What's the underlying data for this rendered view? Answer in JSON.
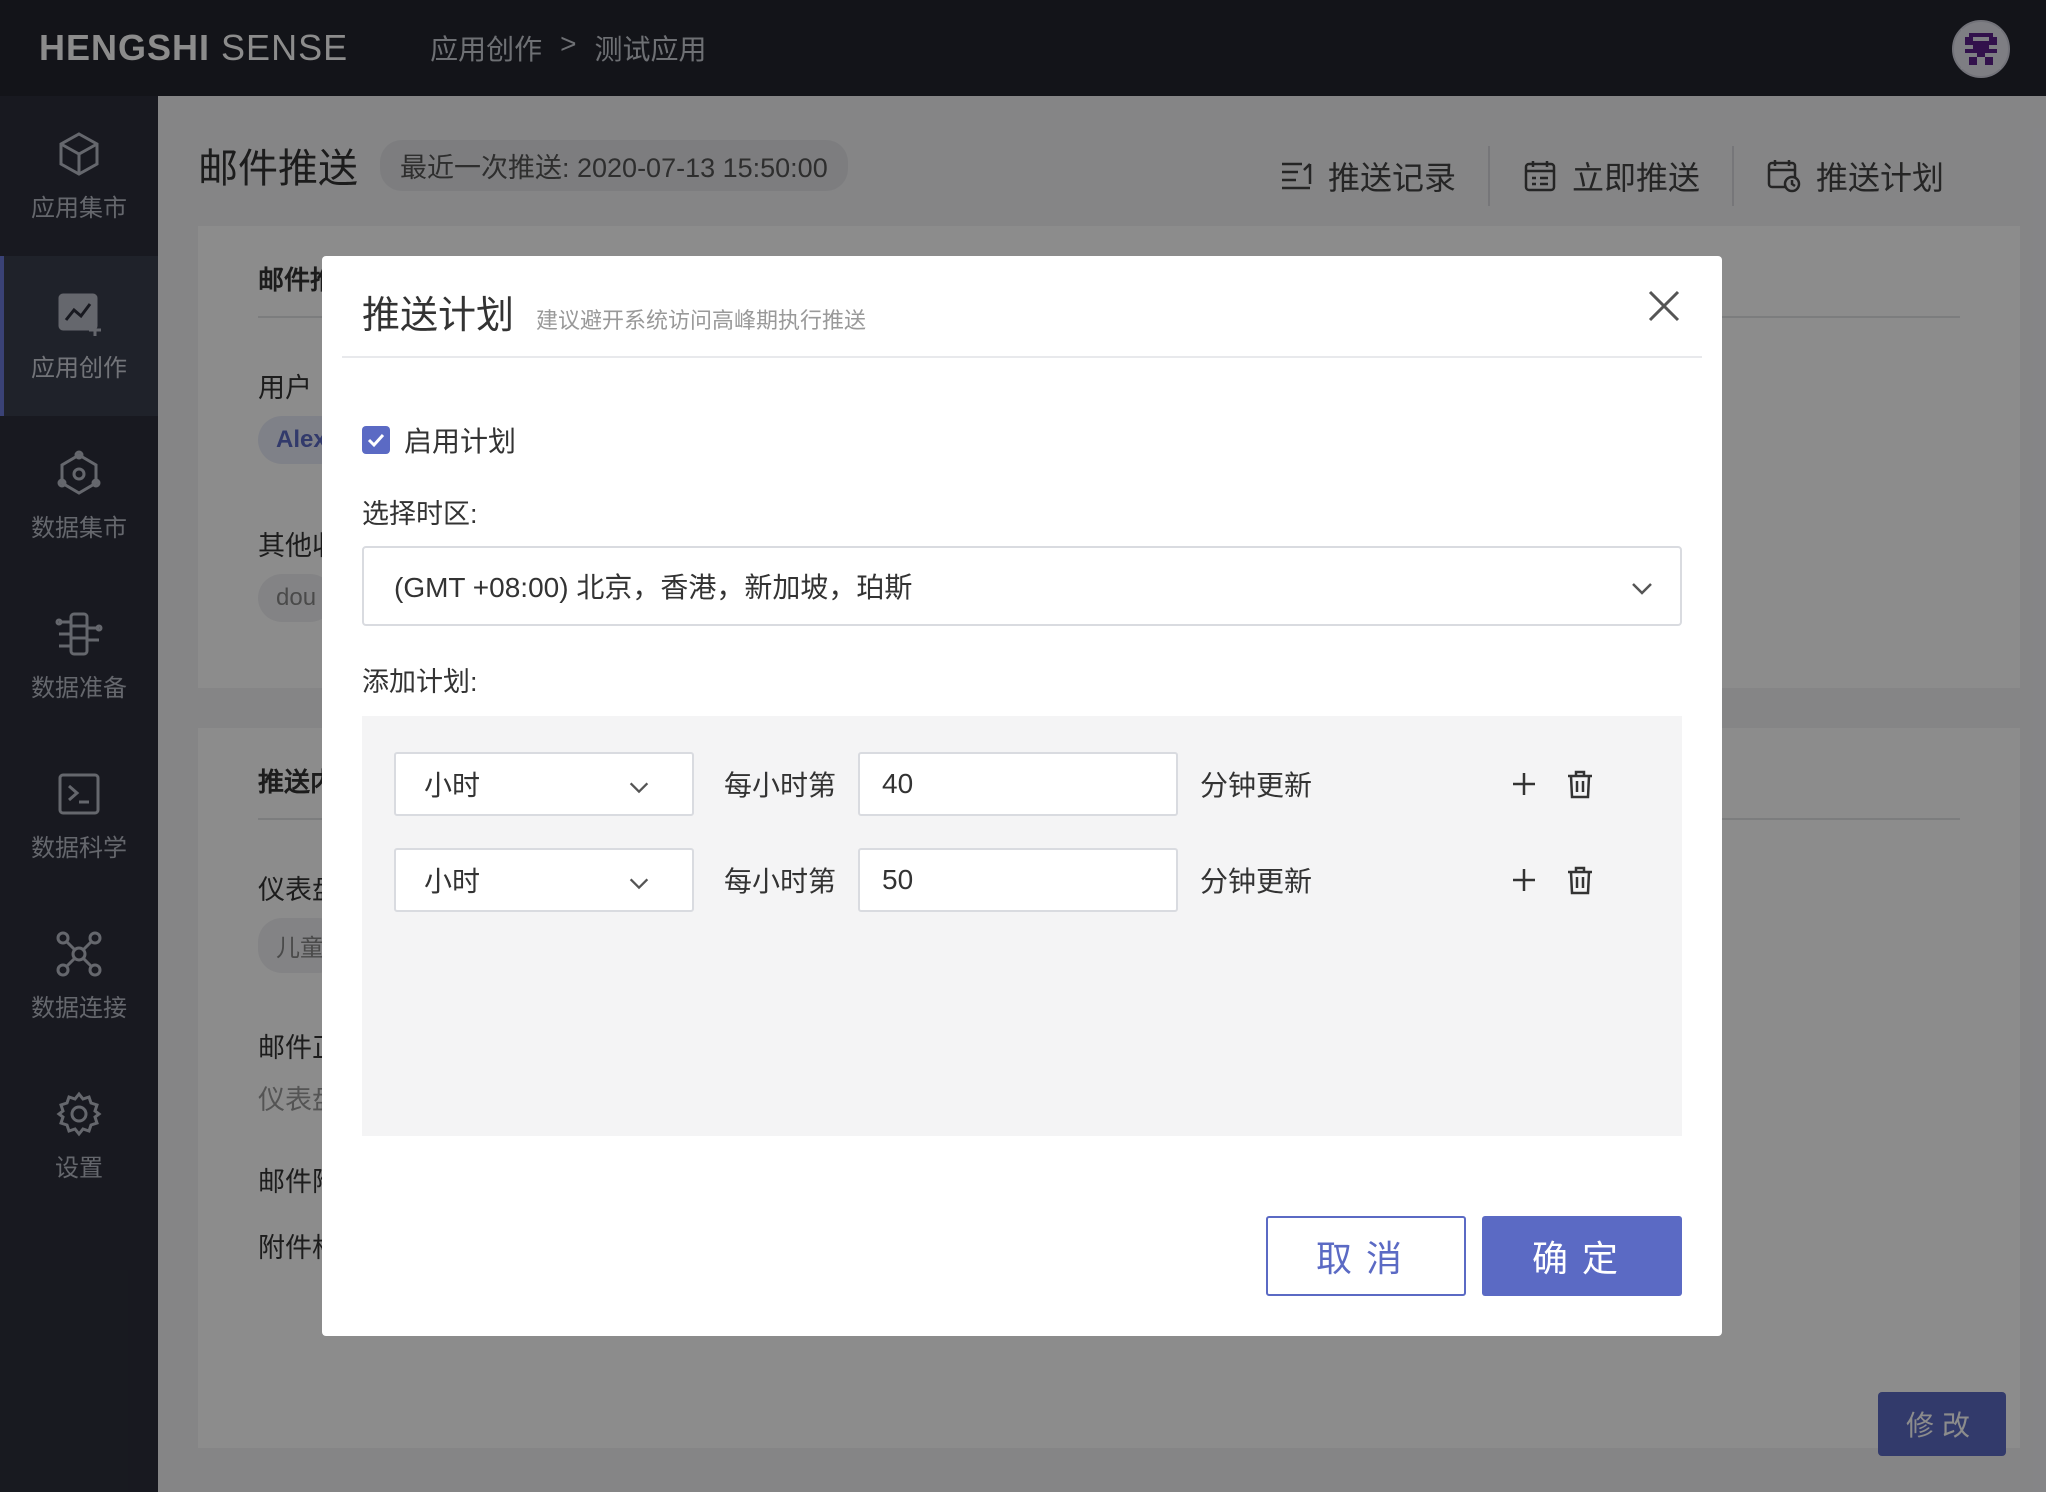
{
  "app": {
    "brand_bold": "HENGSHI",
    "brand_light": "SENSE",
    "breadcrumb": [
      "应用创作",
      ">",
      "测试应用"
    ]
  },
  "sidebar": {
    "items": [
      {
        "label": "应用集市",
        "icon": "cube-icon",
        "active": false
      },
      {
        "label": "应用创作",
        "icon": "chart-edit-icon",
        "active": true
      },
      {
        "label": "数据集市",
        "icon": "hexagon-network-icon",
        "active": false
      },
      {
        "label": "数据准备",
        "icon": "data-prep-icon",
        "active": false
      },
      {
        "label": "数据科学",
        "icon": "terminal-icon",
        "active": false
      },
      {
        "label": "数据连接",
        "icon": "connection-icon",
        "active": false
      },
      {
        "label": "设置",
        "icon": "gear-icon",
        "active": false
      }
    ]
  },
  "page": {
    "title": "邮件推送",
    "last_push": "最近一次推送: 2020-07-13 15:50:00",
    "actions": [
      {
        "label": "推送记录",
        "icon": "list-icon"
      },
      {
        "label": "立即推送",
        "icon": "calendar-icon"
      },
      {
        "label": "推送计划",
        "icon": "schedule-icon"
      }
    ],
    "card1": {
      "title": "邮件推",
      "user_label": "用户",
      "user_pill": "Alex",
      "other_label": "其他收",
      "other_pill": "dou"
    },
    "card2": {
      "title": "推送内",
      "dashboard_label": "仪表盘",
      "dashboard_pill": "儿童",
      "mail_title_label": "邮件正",
      "mail_title_value": "仪表盘",
      "mail_attach_label": "邮件附",
      "attach_label": "附件格"
    },
    "edit_button": "修改"
  },
  "modal": {
    "title": "推送计划",
    "subtitle": "建议避开系统访问高峰期执行推送",
    "enable_label": "启用计划",
    "enable_checked": true,
    "timezone_label": "选择时区:",
    "timezone_value": "(GMT +08:00) 北京，香港，新加坡，珀斯",
    "add_plan_label": "添加计划:",
    "plans": [
      {
        "unit": "小时",
        "prefix": "每小时第",
        "value": "40",
        "suffix": "分钟更新"
      },
      {
        "unit": "小时",
        "prefix": "每小时第",
        "value": "50",
        "suffix": "分钟更新"
      }
    ],
    "cancel_label": "取消",
    "ok_label": "确定"
  },
  "colors": {
    "accent": "#5b6ac4",
    "topbar": "#23252e",
    "sidebar": "#2c2f3b"
  }
}
